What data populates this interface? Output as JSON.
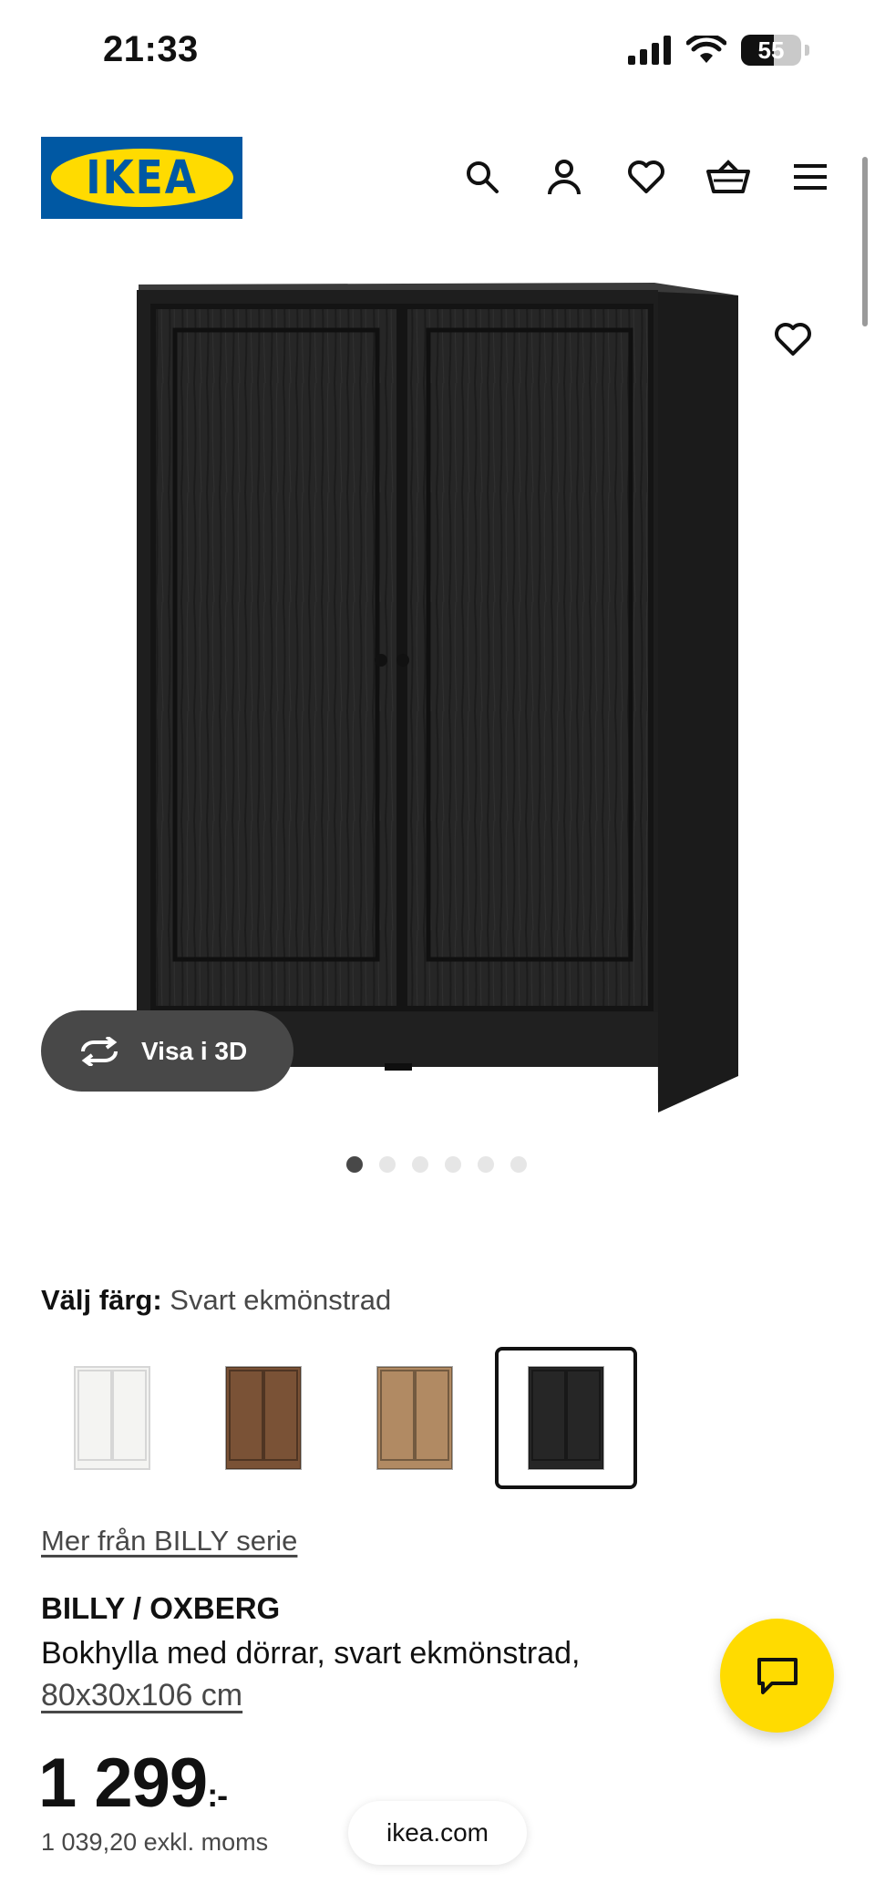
{
  "status_bar": {
    "time": "21:33",
    "battery": "55",
    "battery_level": 0.55
  },
  "header": {
    "logo_text": "IKEA",
    "icons": [
      "search-icon",
      "account-icon",
      "heart-icon",
      "cart-icon",
      "menu-icon"
    ]
  },
  "gallery": {
    "view_3d_label": "Visa i 3D",
    "image_count": 6,
    "active_index": 0
  },
  "color_picker": {
    "label": "Välj färg:",
    "selected": "Svart ekmönstrad",
    "options": [
      {
        "name": "white",
        "color": "#f4f4f2"
      },
      {
        "name": "walnut",
        "color": "#7a5236"
      },
      {
        "name": "oak",
        "color": "#b18a63"
      },
      {
        "name": "black-oak",
        "color": "#262626"
      }
    ],
    "selected_index": 3
  },
  "product": {
    "series_link": "Mer från BILLY serie",
    "name": "BILLY / OXBERG",
    "description": "Bokhylla med dörrar, svart ekmönstrad,",
    "size": "80x30x106 cm",
    "price": "1 299",
    "price_suffix": ":-",
    "price_excl": "1 039,20 exkl. moms"
  },
  "browser": {
    "url": "ikea.com"
  },
  "colors": {
    "brand_blue": "#0058a3",
    "brand_yellow": "#ffdb00",
    "dark_gray": "#484848"
  }
}
